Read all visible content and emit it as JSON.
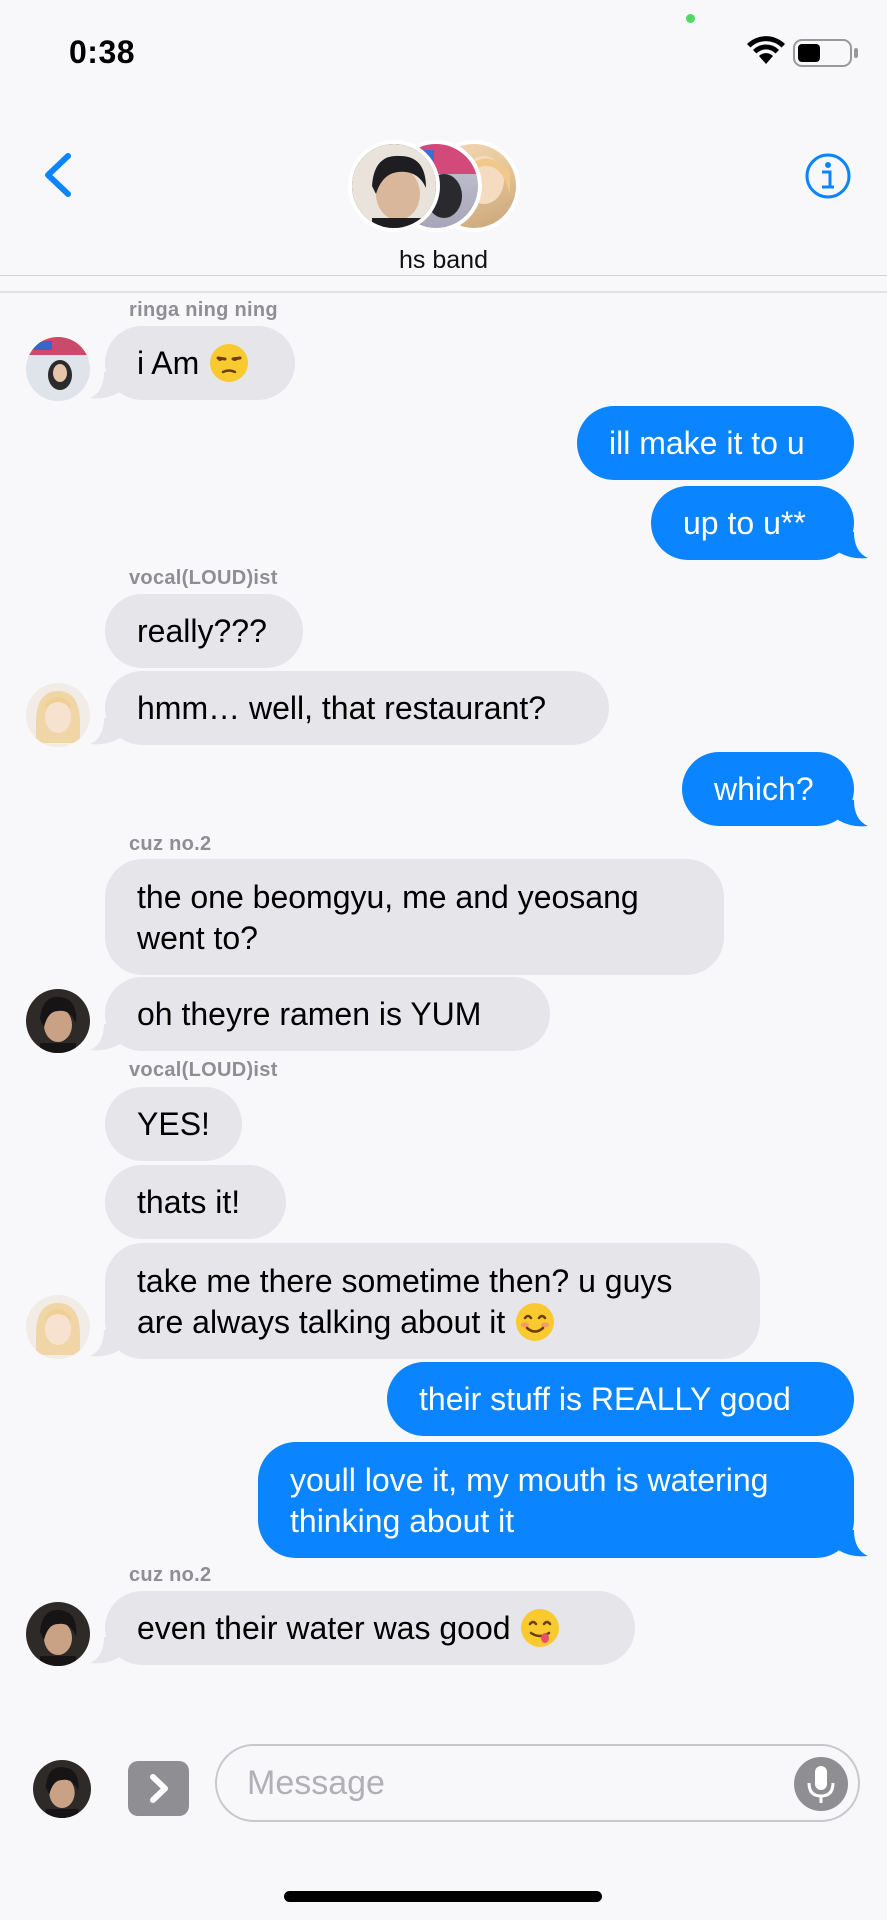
{
  "status_bar": {
    "time": "0:38"
  },
  "header": {
    "group_name": "hs band"
  },
  "colors": {
    "accent": "#0a84ff",
    "incoming_bubble": "#e5e5ea",
    "name_gray": "#8e8e93"
  },
  "messages": [
    {
      "sender": "ringa ning ning",
      "lines": [
        "i Am"
      ],
      "emoji": "unamused",
      "dir": "in"
    },
    {
      "lines": [
        "ill make it to u"
      ],
      "dir": "out"
    },
    {
      "lines": [
        "up to u**"
      ],
      "dir": "out"
    },
    {
      "sender": "vocal(LOUD)ist",
      "lines": [
        "really???"
      ],
      "dir": "in"
    },
    {
      "lines": [
        "hmm… well, that restaurant?"
      ],
      "dir": "in"
    },
    {
      "lines": [
        "which?"
      ],
      "dir": "out"
    },
    {
      "sender": "cuz no.2",
      "lines": [
        "the one beomgyu, me and yeosang",
        "went to?"
      ],
      "dir": "in"
    },
    {
      "lines": [
        "oh theyre ramen is YUM"
      ],
      "dir": "in"
    },
    {
      "sender": "vocal(LOUD)ist",
      "lines": [
        "YES!"
      ],
      "dir": "in"
    },
    {
      "lines": [
        "thats it!"
      ],
      "dir": "in"
    },
    {
      "lines": [
        "take me there sometime then? u guys",
        "are always talking about it"
      ],
      "emoji": "smiling",
      "dir": "in"
    },
    {
      "lines": [
        "their stuff is REALLY good"
      ],
      "dir": "out"
    },
    {
      "lines": [
        "youll love it, my mouth is watering",
        "thinking about it"
      ],
      "dir": "out"
    },
    {
      "sender": "cuz no.2",
      "lines": [
        "even their water was good"
      ],
      "emoji": "yum",
      "dir": "in"
    }
  ],
  "compose": {
    "placeholder": "Message"
  }
}
